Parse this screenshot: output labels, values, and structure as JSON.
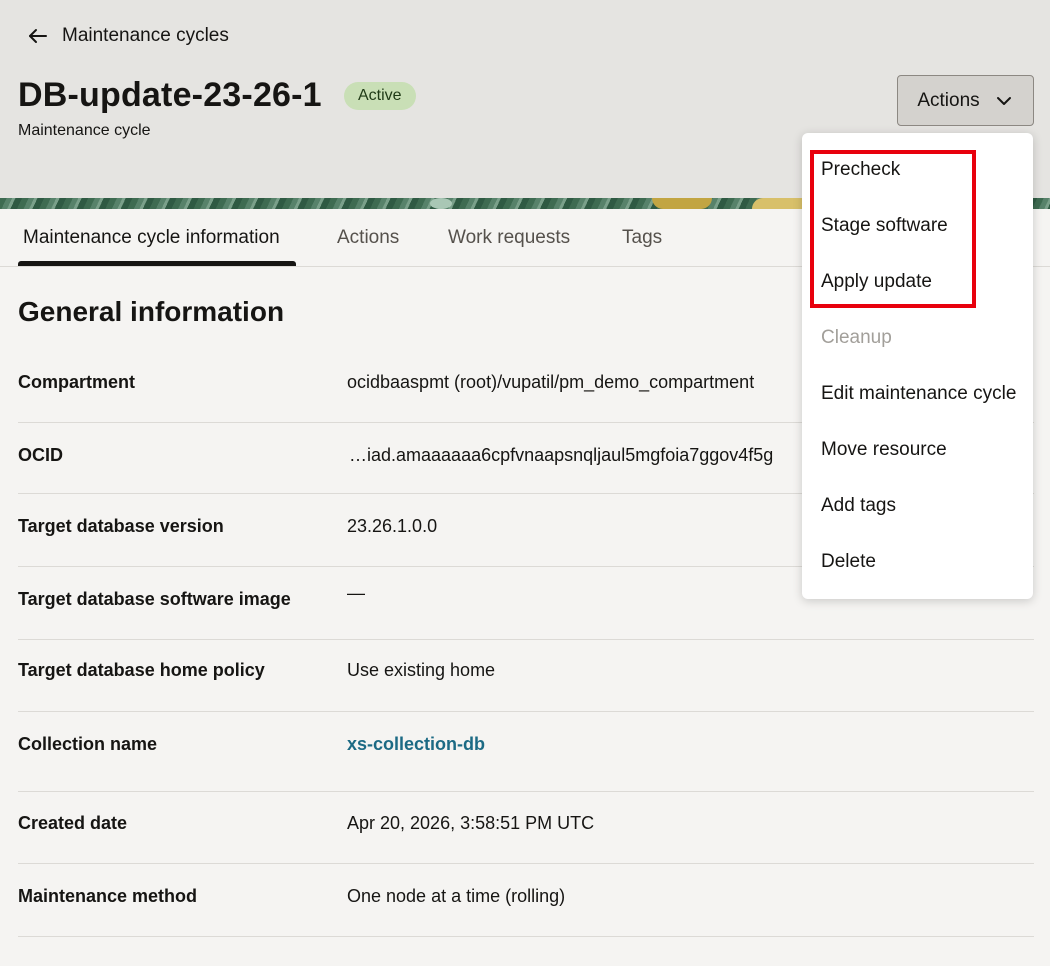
{
  "header": {
    "back_label": "Maintenance cycles",
    "title": "DB-update-23-26-1",
    "status": "Active",
    "subtitle": "Maintenance cycle",
    "actions_label": "Actions"
  },
  "tabs": [
    {
      "label": "Maintenance cycle information",
      "active": true
    },
    {
      "label": "Actions",
      "active": false
    },
    {
      "label": "Work requests",
      "active": false
    },
    {
      "label": "Tags",
      "active": false
    }
  ],
  "section": {
    "title": "General information"
  },
  "info": [
    {
      "label": "Compartment",
      "value": "ocidbaaspmt (root)/vupatil/pm_demo_compartment"
    },
    {
      "label": "OCID",
      "value": "…iad.amaaaaaa6cpfvnaapsnqljaul5mgfoia7ggov4f5g"
    },
    {
      "label": "Target database version",
      "value": "23.26.1.0.0"
    },
    {
      "label": "Target database software image",
      "value": "—"
    },
    {
      "label": "Target database home policy",
      "value": "Use existing home"
    },
    {
      "label": "Collection name",
      "value": "xs-collection-db"
    },
    {
      "label": "Created date",
      "value": "Apr 20, 2026, 3:58:51 PM UTC"
    },
    {
      "label": "Maintenance method",
      "value": "One node at a time (rolling)"
    }
  ],
  "menu": {
    "items": [
      {
        "label": "Precheck",
        "disabled": false
      },
      {
        "label": "Stage software",
        "disabled": false
      },
      {
        "label": "Apply update",
        "disabled": false
      },
      {
        "label": "Cleanup",
        "disabled": true
      },
      {
        "label": "Edit maintenance cycle",
        "disabled": false
      },
      {
        "label": "Move resource",
        "disabled": false
      },
      {
        "label": "Add tags",
        "disabled": false
      },
      {
        "label": "Delete",
        "disabled": false
      }
    ]
  },
  "colors": {
    "highlight": "#e8000d",
    "status_badge": "#c9dfb6",
    "link": "#1c6a84"
  },
  "icons": {
    "back": "arrow-left-icon",
    "actions_caret": "chevron-down-icon"
  }
}
